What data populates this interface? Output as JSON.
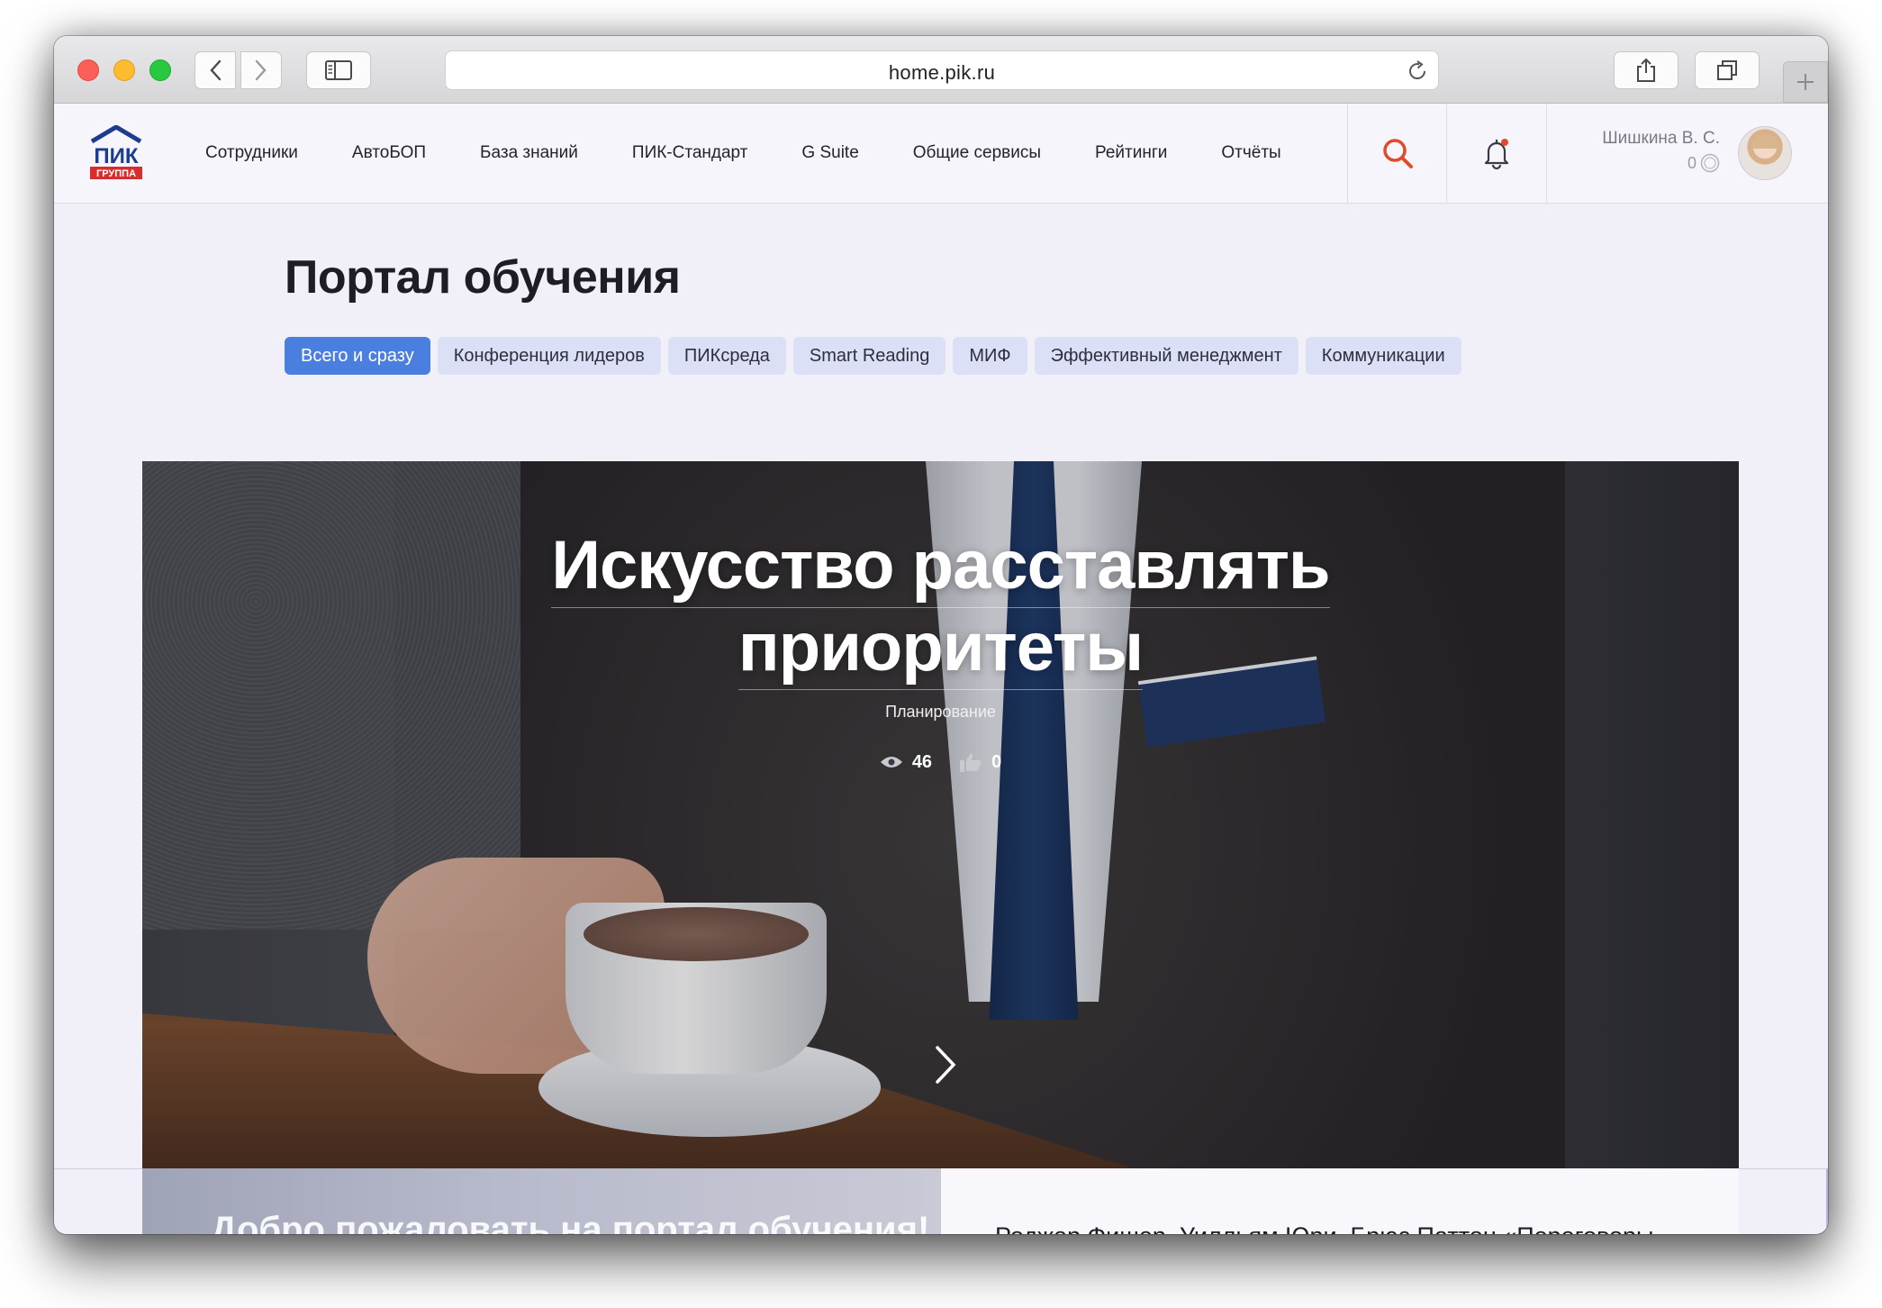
{
  "browser": {
    "url": "home.pik.ru"
  },
  "header": {
    "logo_text": "ПИК",
    "logo_sub": "ГРУППА",
    "nav": [
      "Сотрудники",
      "АвтоБОП",
      "База знаний",
      "ПИК-Стандарт",
      "G Suite",
      "Общие сервисы",
      "Рейтинги",
      "Отчёты"
    ],
    "user_name": "Шишкина В. С.",
    "user_coins": "0",
    "accent_color": "#e04b2a"
  },
  "page": {
    "title": "Портал обучения",
    "chips": [
      "Всего и сразу",
      "Конференция лидеров",
      "ПИКсреда",
      "Smart Reading",
      "МИФ",
      "Эффективный менеджмент",
      "Коммуникации"
    ],
    "active_chip_color": "#4a7fe0"
  },
  "hero": {
    "title_line1": "Искусство расставлять",
    "title_line2": "приоритеты",
    "category": "Планирование",
    "views": "46",
    "likes": "0"
  },
  "cards": {
    "welcome": "Добро пожаловать на портал обучения!",
    "book": "Роджер Фишер, Уилльям Юри, Брюс Паттон «Переговоры"
  }
}
